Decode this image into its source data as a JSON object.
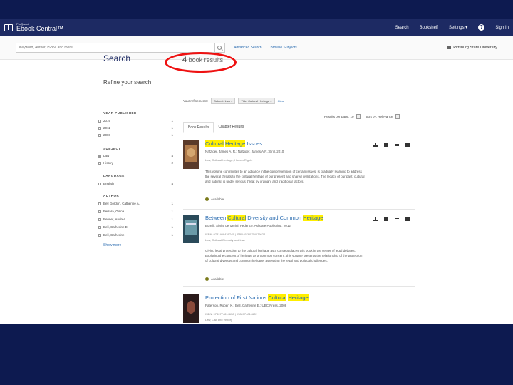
{
  "header": {
    "brand_small": "ProQuest",
    "brand_big": "Ebook Central™",
    "nav": [
      "Search",
      "Bookshelf",
      "Settings ▾",
      "Sign In"
    ]
  },
  "searchbar": {
    "placeholder": "Keyword, Author, ISBN, and more",
    "advanced": "Advanced Search",
    "browse": "Browse Subjects",
    "institution": "Pittsburg State University"
  },
  "sidebar": {
    "title": "Search",
    "refine": "Refine your search",
    "facets": [
      {
        "title": "YEAR PUBLISHED",
        "items": [
          [
            "2016",
            "1"
          ],
          [
            "2011",
            "1"
          ],
          [
            "2008",
            "1"
          ]
        ]
      },
      {
        "title": "SUBJECT",
        "items": [
          [
            "Law",
            "4"
          ],
          [
            "History",
            "2"
          ]
        ]
      },
      {
        "title": "LANGUAGE",
        "items": [
          [
            "English",
            "4"
          ]
        ]
      },
      {
        "title": "AUTHOR",
        "items": [
          [
            "Bell Gordon, Catherine A.",
            "1"
          ],
          [
            "Ferrara, Ginna",
            "1"
          ],
          [
            "Bennet, Andrea",
            "1"
          ],
          [
            "Bell, Catherine E.",
            "1"
          ],
          [
            "Bell, Catherine",
            "1"
          ]
        ]
      }
    ],
    "show_more": "Show more"
  },
  "results": {
    "count": "4",
    "count_label": "book results",
    "sub": "",
    "refinements_label": "Your refinements:",
    "pills": [
      "Subject: Law  ×",
      "Title: Cultural Heritage  ×"
    ],
    "clear": "Clear",
    "sort1": "Results per page: 10",
    "sort2": "Sort by: Relevance",
    "tabs": [
      "Book Results",
      "Chapter Results"
    ],
    "items": [
      {
        "title_hl1": "Cultural",
        "title_mid1": " ",
        "title_hl2": "Heritage",
        "title_rest": " Issues",
        "author": "Nafziger, James A. R.; Nafziger, James A.R.; Brill, 2010",
        "line": "Law, Cultural heritage, Human Rights",
        "desc": "This volume contributes to an advance in the comprehension of certain issues, is gradually learning to address the several threats to the cultural heritage of our present and shared civilizations. The legacy of our past, cultural and natural, is under serious threat by ordinary and traditional factors.",
        "avail": "Available"
      },
      {
        "title_pre": "Between ",
        "title_hl1": "Cultural",
        "title_mid": " Diversity and Common ",
        "title_hl2": "Heritage",
        "author": "Borelli, Silvia; Lenzerini, Federico; Ashgate Publishing, 2012",
        "line": "ISBN: 9781409439745 | ISBN: 9780754675624",
        "line2": "Law, Cultural Diversity and Law",
        "desc": "Giving legal protection to the cultural heritage as a concept places this book in the center of legal debates. Exploring the concept of heritage as a common concern, this volume presents the relationship of the protection of cultural diversity and common heritage, assessing the legal and political challenges.",
        "avail": "Available"
      },
      {
        "title_pre": "Protection of First Nations ",
        "title_hl1": "Cultural",
        "title_mid": " ",
        "title_hl2": "Heritage",
        "author": "Paterson, Robert K.; Bell, Catherine E.; UBC Press, 2008",
        "line": "ISBN: 9780774814638 | 9780774814622",
        "line2": "Law, Law and History"
      }
    ]
  }
}
